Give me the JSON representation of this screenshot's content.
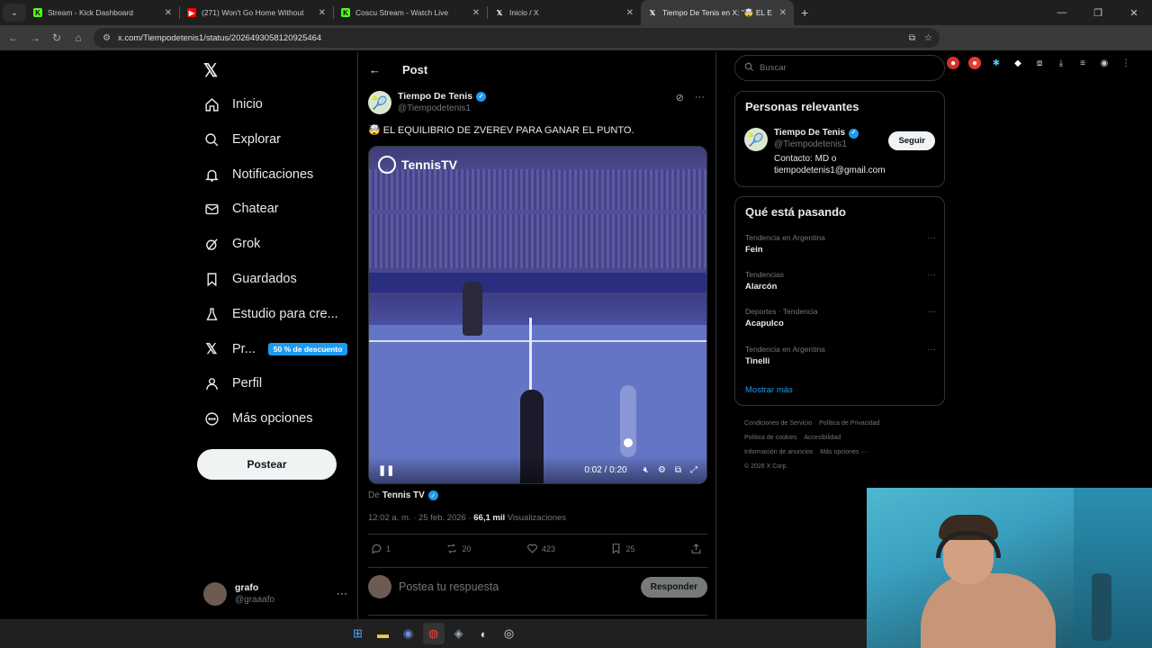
{
  "browser": {
    "tabs": [
      {
        "title": "Stream - Kick Dashboard",
        "icon": "kick-icon",
        "color": "#53fc18",
        "active": false
      },
      {
        "title": "(271) Won't Go Home Without",
        "icon": "youtube-icon",
        "color": "#ff0000",
        "active": false
      },
      {
        "title": "Coscu Stream - Watch Live",
        "icon": "kick-icon",
        "color": "#53fc18",
        "active": false
      },
      {
        "title": "Inicio / X",
        "icon": "x-icon",
        "color": "#ffffff",
        "active": false
      },
      {
        "title": "Tiempo De Tenis en X: \"🤯 EL E",
        "icon": "x-icon",
        "color": "#ffffff",
        "active": true
      }
    ],
    "url": "x.com/Tiempodetenis1/status/2026493058120925464"
  },
  "nav": {
    "items": [
      {
        "label": "Inicio",
        "icon": "home-icon"
      },
      {
        "label": "Explorar",
        "icon": "search-icon"
      },
      {
        "label": "Notificaciones",
        "icon": "bell-icon"
      },
      {
        "label": "Chatear",
        "icon": "mail-icon"
      },
      {
        "label": "Grok",
        "icon": "grok-icon"
      },
      {
        "label": "Guardados",
        "icon": "bookmark-icon"
      },
      {
        "label": "Estudio para cre...",
        "icon": "flask-icon"
      },
      {
        "label": "Pr...",
        "icon": "x-premium-icon"
      },
      {
        "label": "Perfil",
        "icon": "person-icon"
      },
      {
        "label": "Más opciones",
        "icon": "more-circle-icon"
      }
    ],
    "premium_badge": "50 % de descuento",
    "post_button": "Postear",
    "account": {
      "name": "grafo",
      "handle": "@graaafo"
    }
  },
  "post": {
    "header": "Post",
    "author": {
      "name": "Tiempo De Tenis",
      "handle": "@Tiempodetenis1"
    },
    "text": "🤯 EL EQUILIBRIO DE ZVEREV PARA GANAR EL PUNTO.",
    "video": {
      "brand": "TennisTV",
      "time": "0:02 / 0:20",
      "volume_level": 0.2
    },
    "from_label": "De",
    "from_name": "Tennis TV",
    "timestamp": "12:02 a. m. · 25 feb. 2026 · ",
    "views_count": "66,1 mil",
    "views_label": " Visualizaciones",
    "replies": "1",
    "reposts": "20",
    "likes": "423",
    "bookmarks": "25",
    "reply_placeholder": "Postea tu respuesta",
    "reply_button": "Responder"
  },
  "sidebar": {
    "search_placeholder": "Buscar",
    "relevant_title": "Personas relevantes",
    "relevant": {
      "name": "Tiempo De Tenis",
      "handle": "@Tiempodetenis1",
      "bio": "Contacto: MD o tiempodetenis1@gmail.com",
      "follow": "Seguir"
    },
    "trending_title": "Qué está pasando",
    "trends": [
      {
        "category": "Tendencia en Argentina",
        "name": "Fein"
      },
      {
        "category": "Tendencias",
        "name": "Alarcón"
      },
      {
        "category": "Deportes · Tendencia",
        "name": "Acapulco"
      },
      {
        "category": "Tendencia en Argentina",
        "name": "Tinelli"
      }
    ],
    "show_more": "Mostrar más",
    "footer": [
      "Condiciones de Servicio",
      "Política de Privacidad",
      "Política de cookies",
      "Accesibilidad",
      "Información de anuncios",
      "Más opciones ···",
      "© 2026 X Corp."
    ]
  },
  "colors": {
    "accent": "#1d9bf0",
    "background": "#000000"
  }
}
